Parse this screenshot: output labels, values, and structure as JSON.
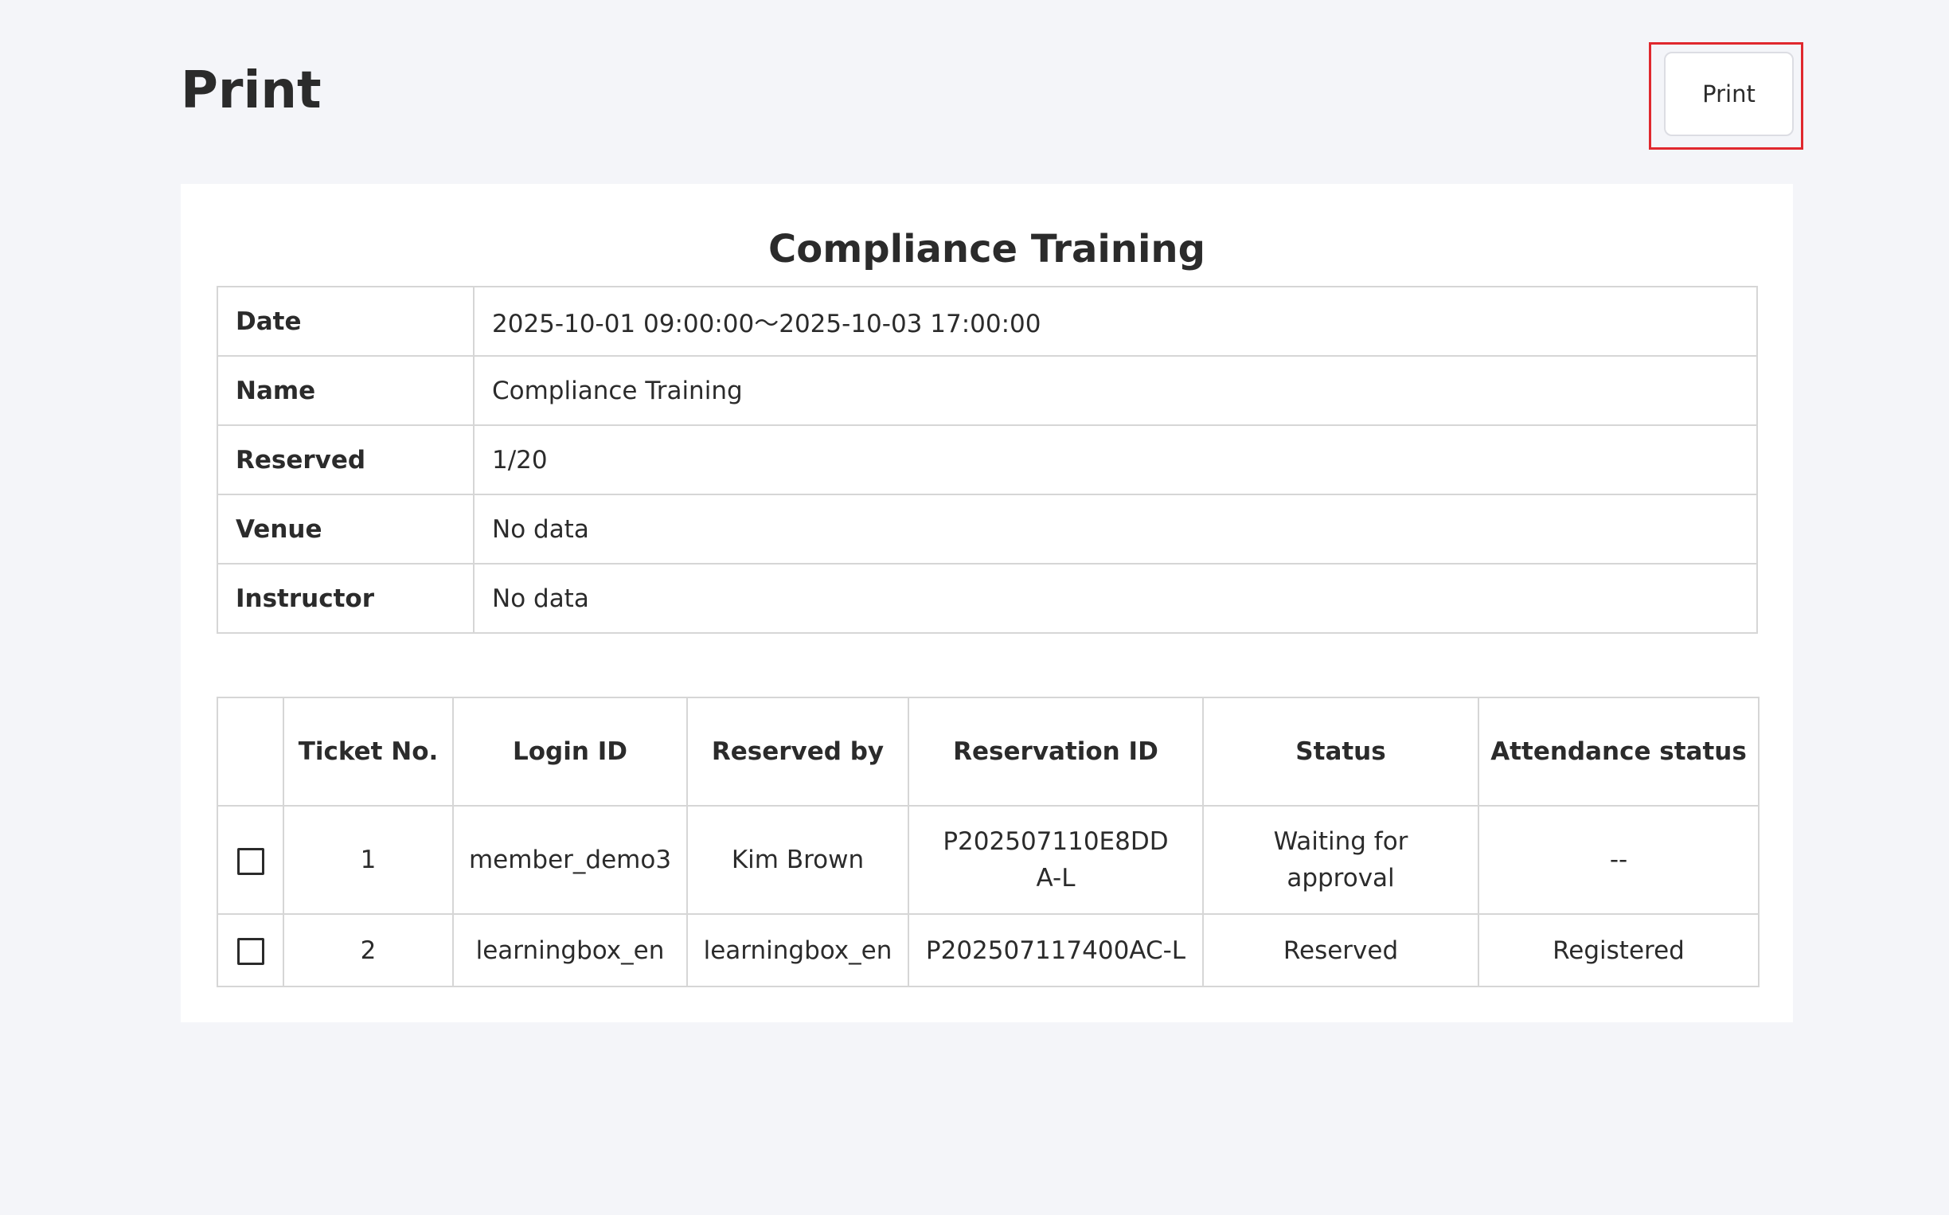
{
  "page": {
    "title": "Print",
    "print_button_label": "Print"
  },
  "document": {
    "title": "Compliance Training",
    "info_rows": [
      {
        "label": "Date",
        "value": "2025-10-01 09:00:00～2025-10-03 17:00:00"
      },
      {
        "label": "Name",
        "value": "Compliance Training"
      },
      {
        "label": "Reserved",
        "value": "1/20"
      },
      {
        "label": "Venue",
        "value": "No data"
      },
      {
        "label": "Instructor",
        "value": "No data"
      }
    ],
    "reservations": {
      "headers": [
        "",
        "Ticket No.",
        "Login ID",
        "Reserved by",
        "Reservation ID",
        "Status",
        "Attendance status"
      ],
      "rows": [
        {
          "checked": false,
          "ticket_no": "1",
          "login_id": "member_demo3",
          "reserved_by": "Kim Brown",
          "reservation_id": "P202507110E8DDA-L",
          "status": "Waiting for approval",
          "attendance": "--"
        },
        {
          "checked": false,
          "ticket_no": "2",
          "login_id": "learningbox_en",
          "reserved_by": "learningbox_en",
          "reservation_id": "P202507117400AC-L",
          "status": "Reserved",
          "attendance": "Registered"
        }
      ]
    }
  },
  "colors": {
    "background": "#f4f5f9",
    "highlight_border": "#e0282e",
    "table_border": "#d6d6d6"
  }
}
